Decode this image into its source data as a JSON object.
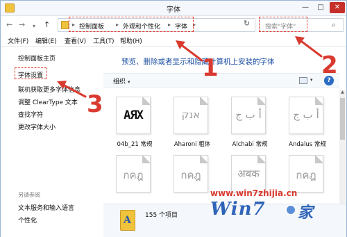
{
  "window": {
    "title": "字体",
    "controls": {
      "min": "—",
      "max": "□",
      "close": "✕"
    }
  },
  "nav": {
    "back": "←",
    "forward": "→",
    "dropdown": "▾",
    "up": "↑",
    "crumbs": [
      "控制面板",
      "外观和个性化",
      "字体"
    ],
    "separator": "▸",
    "refresh": "↻",
    "search_placeholder": "搜索\"字体\""
  },
  "menubar": [
    "文件(F)",
    "编辑(E)",
    "查看(V)",
    "工具(T)",
    "帮助(H)"
  ],
  "left_pane": {
    "links": [
      "控制面板主页",
      "字体设置",
      "联机获取更多字体信息",
      "调整 ClearType 文本",
      "查找字符",
      "更改字体大小"
    ],
    "see_also_heading": "另请参阅",
    "see_also": [
      "文本服务和输入语言",
      "个性化"
    ]
  },
  "main": {
    "heading": "预览、删除或者显示和隐藏计算机上安装的字体",
    "organize": "组织",
    "organize_arrow": "▾",
    "view_dropdown": "▾",
    "help": "?",
    "fonts": [
      {
        "glyph": "AЯX",
        "label": "04b_21 常规"
      },
      {
        "glyph": "אנק",
        "label": "Aharoni 粗体"
      },
      {
        "glyph": "أ ب ج",
        "label": "Alchabi 常规"
      },
      {
        "glyph": "أ ب ج",
        "label": "Andalus 常规"
      },
      {
        "glyph": "กคฎ",
        "label": ""
      },
      {
        "glyph": "กคฎ",
        "label": ""
      },
      {
        "glyph": "अबक",
        "label": ""
      },
      {
        "glyph": "กคฎ",
        "label": ""
      }
    ],
    "status_count": "155 个项目"
  },
  "annotations": {
    "n1": "1",
    "n2": "2",
    "n3": "3",
    "color": "#d93a30"
  },
  "watermark": {
    "url": "www.win7zhijia.cn",
    "brand": "Win7",
    "brand_tail": "家"
  }
}
